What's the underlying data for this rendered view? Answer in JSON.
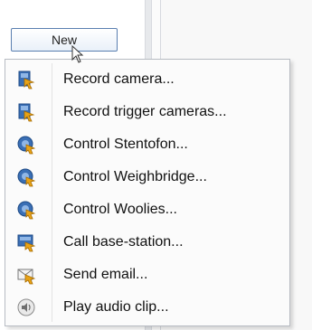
{
  "new_button": {
    "label": "New"
  },
  "menu": {
    "items": [
      {
        "label": "Record camera...",
        "icon": "record-camera-icon"
      },
      {
        "label": "Record trigger cameras...",
        "icon": "record-trigger-cameras-icon"
      },
      {
        "label": "Control Stentofon...",
        "icon": "control-stentofon-icon"
      },
      {
        "label": "Control Weighbridge...",
        "icon": "control-weighbridge-icon"
      },
      {
        "label": "Control Woolies...",
        "icon": "control-woolies-icon"
      },
      {
        "label": "Call base-station...",
        "icon": "call-base-station-icon"
      },
      {
        "label": "Send email...",
        "icon": "send-email-icon"
      },
      {
        "label": "Play audio clip...",
        "icon": "play-audio-clip-icon"
      }
    ]
  },
  "colors": {
    "button_border": "#5a7fb0",
    "menu_border": "#b8bcc3",
    "icon_blue": "#3a6fb5",
    "icon_orange": "#e8a317"
  }
}
